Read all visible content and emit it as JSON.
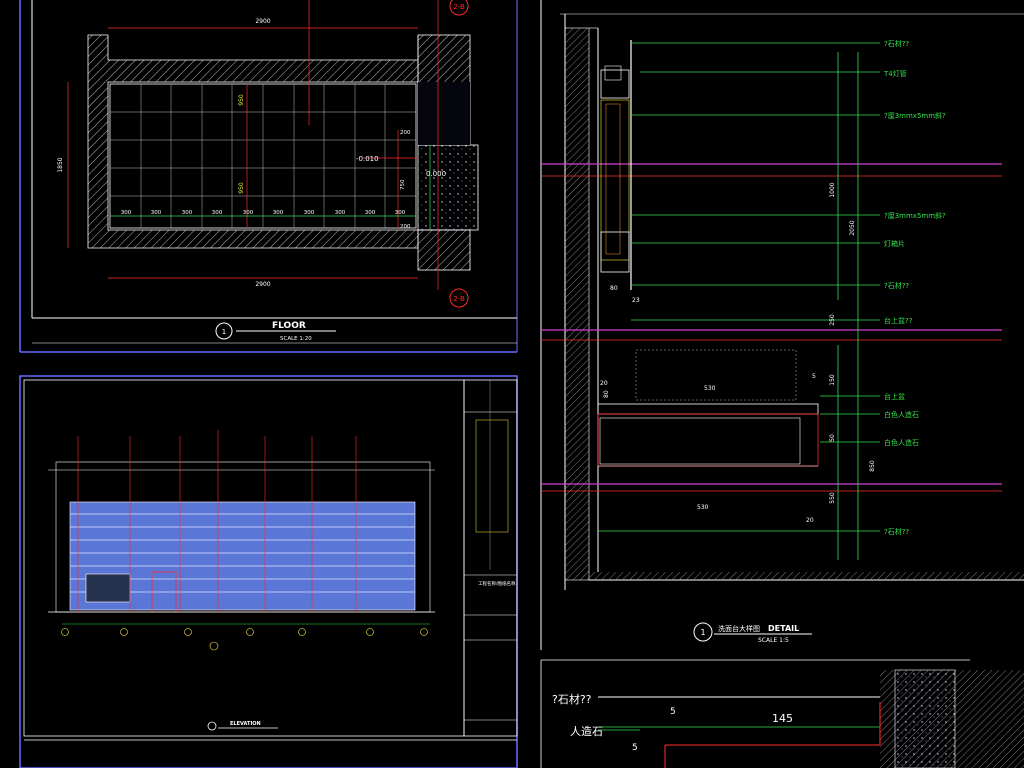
{
  "floor": {
    "title": "FLOOR",
    "scale": "SCALE   1:20",
    "grid_id": "1",
    "dims_top": "2900",
    "dims_bottom": "2900",
    "dim_left": "1850",
    "dim_mid": "950",
    "dim_lower": "950",
    "tile_row": [
      "300",
      "300",
      "300",
      "300",
      "300",
      "300",
      "300",
      "300",
      "300",
      "300"
    ],
    "level_a": "-0.010",
    "level_b": "0.000",
    "dim_right_1": "200",
    "dim_right_2": "750",
    "dim_right_3": "200",
    "section_top": "2-B",
    "section_bottom": "2-B"
  },
  "elevation": {
    "title": "ELEVATION",
    "title_block_note": "工程名称/图纸名称"
  },
  "detail": {
    "number": "1",
    "title_cn": "洗面台大样图",
    "title_en": "DETAIL",
    "scale": "SCALE  1:5",
    "labels": [
      "?石材??",
      "T4灯管",
      "?厘3mmx5mm斜?",
      "?厘3mmx5mm斜?",
      "灯箱片",
      "?石材??",
      "台上盆??",
      "台上盆",
      "白色人造石",
      "白色人造石",
      "?石材??"
    ],
    "dims": {
      "d1000": "1000",
      "d2050": "2050",
      "d250": "250",
      "d150": "150",
      "d50": "50",
      "d550": "550",
      "d850": "850",
      "d80": "80",
      "d23": "23",
      "d530a": "530",
      "d530b": "530",
      "d20a": "20",
      "d20b": "20",
      "d5": "5",
      "d80b": "80"
    }
  },
  "bottom_detail": {
    "label_stone": "?石材??",
    "label_artificial": "人造石",
    "dim_145": "145",
    "dim_5a": "5",
    "dim_5b": "5"
  }
}
